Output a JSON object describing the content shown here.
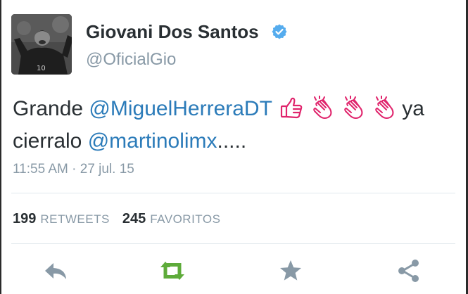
{
  "tweet": {
    "display_name": "Giovani Dos Santos",
    "handle": "@OficialGio",
    "text_parts": {
      "intro": "Grande ",
      "mention_1": "@MiguelHerreraDT",
      "after_emoji": " ya",
      "line2_start": "cierralo ",
      "mention_2": "@martinolimx",
      "ending": "....."
    },
    "timestamp": "11:55 AM · 27 jul. 15",
    "retweets_count": "199",
    "retweets_label": "RETWEETS",
    "favorites_count": "245",
    "favorites_label": "FAVORITOS"
  },
  "icons": {
    "verified": "verified-badge-icon",
    "emoji_1": "thumbs-up-emoji",
    "emoji_2": "clapping-hands-emoji",
    "reply": "reply-icon",
    "retweet": "retweet-icon",
    "favorite": "star-icon",
    "share": "share-icon"
  },
  "colors": {
    "link": "#2b7bb9",
    "verified": "#55acee",
    "muted": "#8899a6",
    "retweet_green": "#5eab3a",
    "emoji_pink": "#e0246c"
  }
}
